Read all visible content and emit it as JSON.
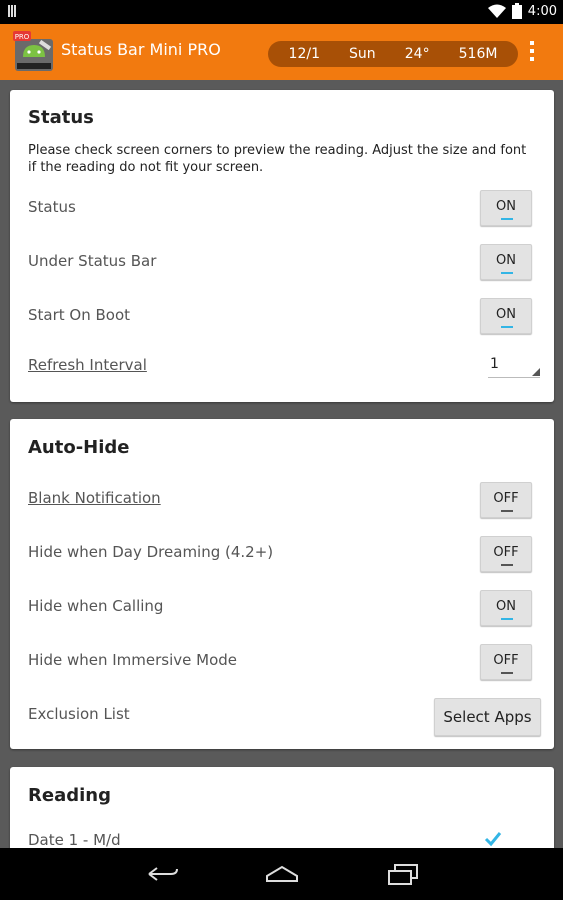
{
  "statusbar": {
    "time": "4:00"
  },
  "actionbar": {
    "title": "Status Bar Mini PRO",
    "preview": [
      "12/1",
      "Sun",
      "24°",
      "516M"
    ]
  },
  "status_card": {
    "title": "Status",
    "description": "Please check screen corners to preview the reading. Adjust the size and font if the reading do not fit your screen.",
    "rows": [
      {
        "label": "Status",
        "value": "ON"
      },
      {
        "label": "Under Status Bar",
        "value": "ON"
      },
      {
        "label": "Start On Boot",
        "value": "ON"
      }
    ],
    "refresh_label": "Refresh Interval",
    "refresh_value": "1"
  },
  "autohide_card": {
    "title": "Auto-Hide",
    "rows": [
      {
        "label": "Blank Notification",
        "value": "OFF"
      },
      {
        "label": "Hide when Day Dreaming (4.2+)",
        "value": "OFF"
      },
      {
        "label": "Hide when Calling",
        "value": "ON"
      },
      {
        "label": "Hide when Immersive Mode",
        "value": "OFF"
      }
    ],
    "exclusion_label": "Exclusion List",
    "select_apps_label": "Select Apps"
  },
  "reading_card": {
    "title": "Reading",
    "rows": [
      {
        "label": "Date 1 - M/d",
        "checked": true
      }
    ]
  },
  "colors": {
    "accent": "#f27a0f",
    "toggle_on": "#33b5e5"
  }
}
